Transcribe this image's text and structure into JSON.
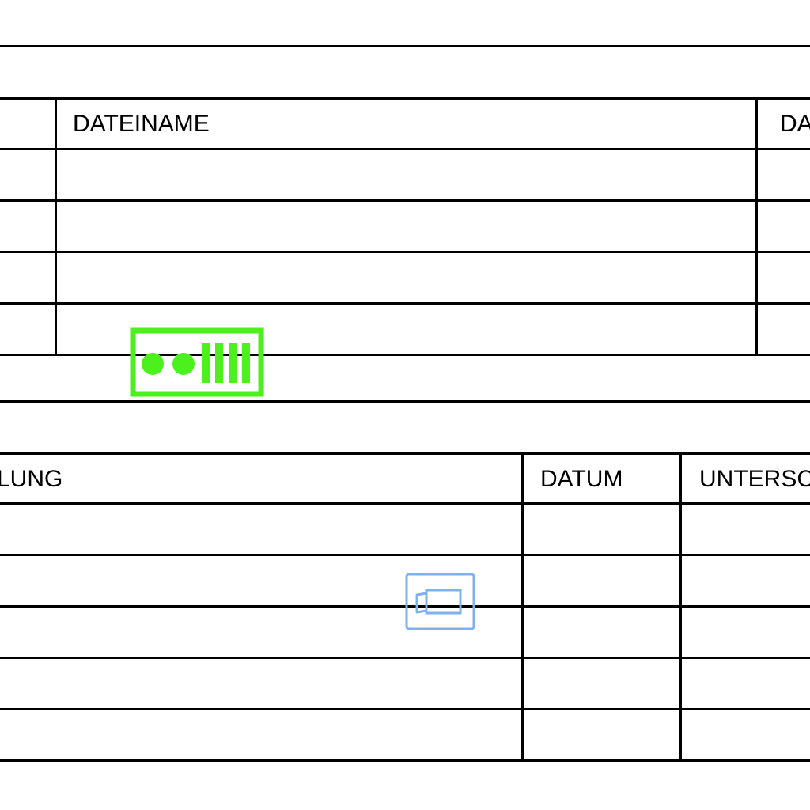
{
  "table1": {
    "columns": [
      "",
      "DATEINAME",
      "DA"
    ],
    "rows": [
      [
        "",
        "",
        ""
      ],
      [
        "",
        "",
        ""
      ],
      [
        "",
        "",
        ""
      ],
      [
        "",
        "",
        ""
      ]
    ]
  },
  "table2": {
    "columns": [
      "LUNG",
      "DATUM",
      "UNTERSC"
    ],
    "rows": [
      [
        "",
        "",
        ""
      ],
      [
        "",
        "",
        ""
      ],
      [
        "",
        "",
        ""
      ],
      [
        "",
        "",
        ""
      ],
      [
        "",
        "",
        ""
      ]
    ]
  },
  "icons": {
    "battery": {
      "name": "battery-level-icon",
      "color": "#4cf01c"
    },
    "camera": {
      "name": "video-camera-icon",
      "color": "#7fb2ec"
    }
  }
}
